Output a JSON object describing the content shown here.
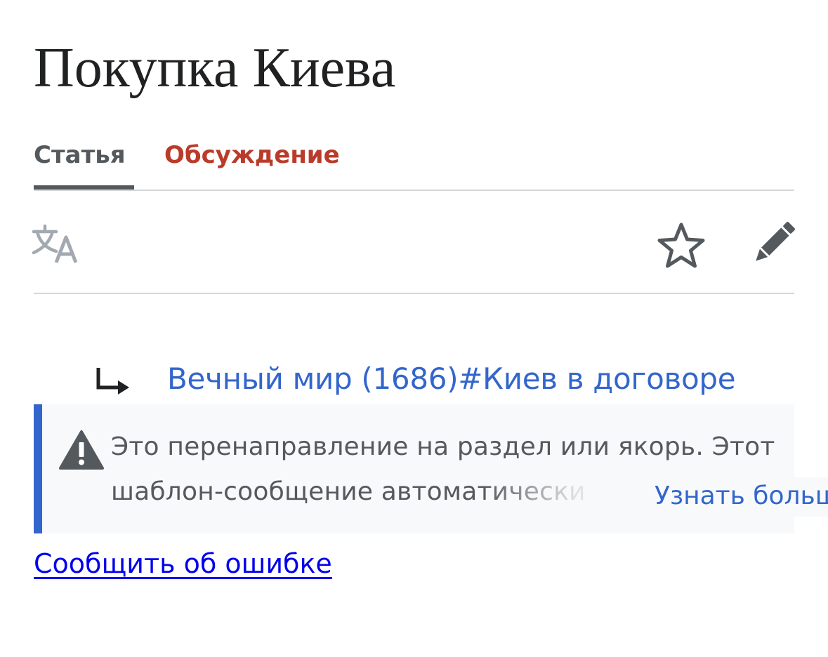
{
  "page": {
    "title": "Покупка Киева"
  },
  "tabs": [
    {
      "label": "Статья",
      "selected": true
    },
    {
      "label": "Обсуждение",
      "selected": false
    }
  ],
  "toolbar": {
    "icons": [
      "translate-icon",
      "star-icon",
      "pencil-icon"
    ]
  },
  "redirect": {
    "icon": "redirect-arrow-icon",
    "target_label": "Вечный мир (1686)#Киев в договоре"
  },
  "notice": {
    "icon": "warning-icon",
    "line1": "Это перенаправление на раздел или якорь. Этот",
    "line2": "шаблон-сообщение автоматически",
    "learn_more_label": "Узнать больше",
    "accent_color": "#3366cc"
  },
  "footer": {
    "report_label": "Сообщить об ошибке"
  },
  "colors": {
    "tab_selected": "#54595d",
    "tab_talk": "#ba3b2a",
    "link": "#3366cc",
    "visited_link": "#0000ee"
  }
}
